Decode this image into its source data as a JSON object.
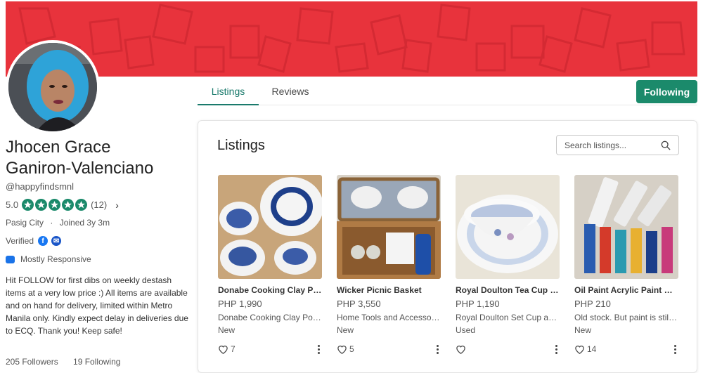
{
  "colors": {
    "banner": "#e8333c",
    "accent": "#1b8a6b",
    "facebook": "#1877f2",
    "email": "#1a56c8"
  },
  "tabs": [
    {
      "label": "Listings",
      "active": true
    },
    {
      "label": "Reviews",
      "active": false
    }
  ],
  "follow_button": "Following",
  "profile": {
    "name_line1": "Jhocen Grace",
    "name_line2": "Ganiron-Valenciano",
    "handle": "@happyfindsmnl",
    "rating": "5.0",
    "review_count": "(12)",
    "location": "Pasig City",
    "separator": "·",
    "joined": "Joined 3y 3m",
    "verified_label": "Verified",
    "responsiveness": "Mostly Responsive",
    "bio": "Hit FOLLOW for first dibs on weekly destash items at a very low price :) All items are available and on hand for delivery, limited within Metro Manila only. Kindly expect delay in deliveries due to ECQ. Thank you! Keep safe!",
    "followers": "205 Followers",
    "following": "19 Following"
  },
  "listings": {
    "title": "Listings",
    "search_placeholder": "Search listings...",
    "items": [
      {
        "title": "Donabe Cooking Clay Pot Set",
        "price": "PHP 1,990",
        "desc": "Donabe Cooking Clay Pot Set",
        "condition": "New",
        "likes": "7",
        "image": "blue-white-ceramics"
      },
      {
        "title": "Wicker Picnic Basket",
        "price": "PHP 3,550",
        "desc": "Home Tools and Accessories",
        "condition": "New",
        "likes": "5",
        "image": "picnic-basket"
      },
      {
        "title": "Royal Doulton Tea Cup n Saucer",
        "price": "PHP 1,190",
        "desc": "Royal Doulton Set Cup and Saucer",
        "condition": "Used",
        "likes": "",
        "image": "floral-teacup"
      },
      {
        "title": "Oil Paint Acrylic Paint Watercolor",
        "price": "PHP 210",
        "desc": "Old stock. But paint is still good",
        "condition": "New",
        "likes": "14",
        "image": "paint-tubes"
      }
    ]
  }
}
